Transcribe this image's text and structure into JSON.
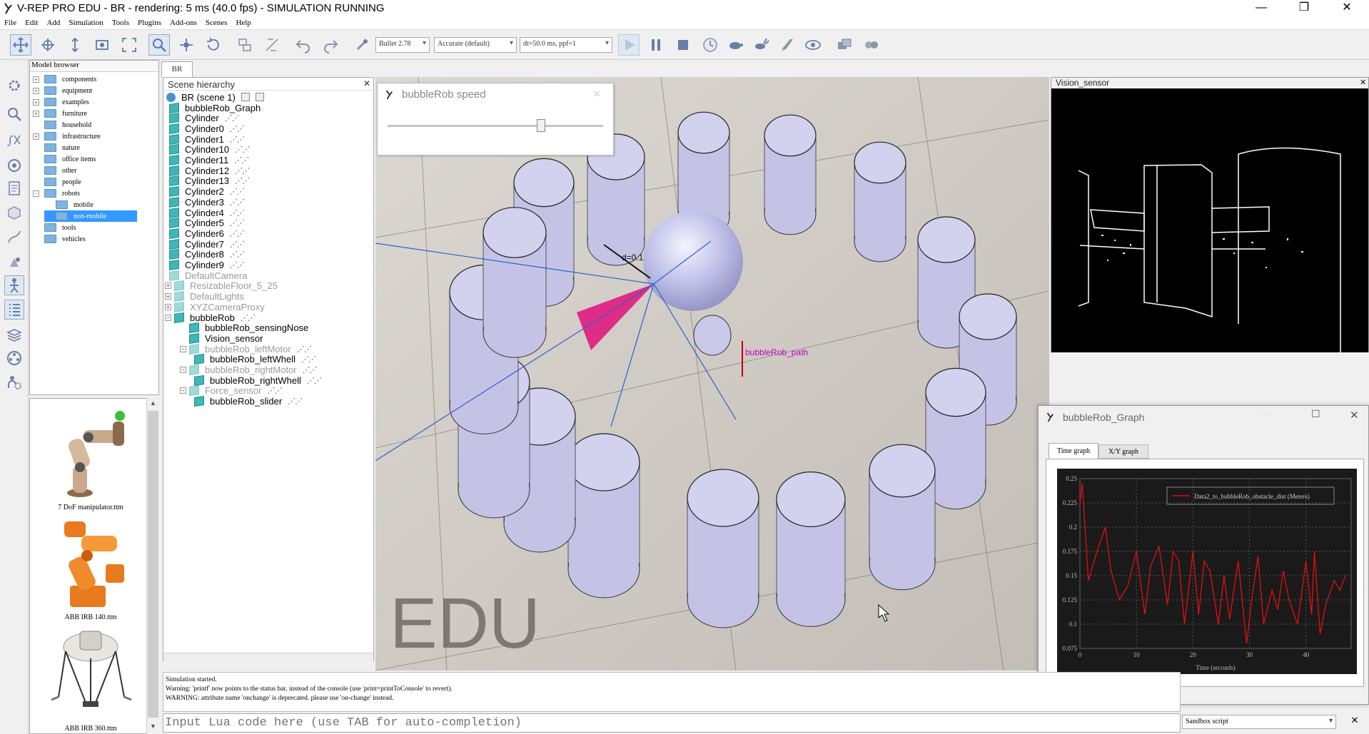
{
  "window": {
    "title": "V-REP PRO EDU - BR - rendering: 5 ms (40.0 fps) - SIMULATION RUNNING",
    "minimize": "—",
    "restore": "❐",
    "close": "✕"
  },
  "menu": [
    "File",
    "Edit",
    "Add",
    "Simulation",
    "Tools",
    "Plugins",
    "Add-ons",
    "Scenes",
    "Help"
  ],
  "toolbar": {
    "engine": "Bullet 2.78",
    "accuracy": "Accurate (default)",
    "timestep": "dt=50.0 ms, ppf=1"
  },
  "model_browser": {
    "header": "Model browser",
    "items": [
      {
        "label": "components",
        "exp": "+"
      },
      {
        "label": "equipment",
        "exp": "+"
      },
      {
        "label": "examples",
        "exp": "+"
      },
      {
        "label": "furniture",
        "exp": "+"
      },
      {
        "label": "household",
        "exp": ""
      },
      {
        "label": "infrastructure",
        "exp": "+"
      },
      {
        "label": "nature",
        "exp": ""
      },
      {
        "label": "office items",
        "exp": ""
      },
      {
        "label": "other",
        "exp": ""
      },
      {
        "label": "people",
        "exp": ""
      },
      {
        "label": "robots",
        "exp": "−"
      },
      {
        "label": "mobile",
        "exp": ""
      },
      {
        "label": "non-mobile",
        "exp": ""
      },
      {
        "label": "tools",
        "exp": ""
      },
      {
        "label": "vehicles",
        "exp": ""
      }
    ],
    "selected": "non-mobile",
    "thumbnails": [
      "7 DoF manipulator.ttm",
      "ABB IRB 140.ttm",
      "ABB IRB 360.ttm"
    ]
  },
  "scene_tab": "BR",
  "scene_hierarchy": {
    "header": "Scene hierarchy",
    "close": "✕",
    "root": "BR (scene 1)",
    "items": [
      {
        "label": "bubbleRob_Graph",
        "dim": false
      },
      {
        "label": "Cylinder",
        "dim": false
      },
      {
        "label": "Cylinder0",
        "dim": false
      },
      {
        "label": "Cylinder1",
        "dim": false
      },
      {
        "label": "Cylinder10",
        "dim": false
      },
      {
        "label": "Cylinder11",
        "dim": false
      },
      {
        "label": "Cylinder12",
        "dim": false
      },
      {
        "label": "Cylinder13",
        "dim": false
      },
      {
        "label": "Cylinder2",
        "dim": false
      },
      {
        "label": "Cylinder3",
        "dim": false
      },
      {
        "label": "Cylinder4",
        "dim": false
      },
      {
        "label": "Cylinder5",
        "dim": false
      },
      {
        "label": "Cylinder6",
        "dim": false
      },
      {
        "label": "Cylinder7",
        "dim": false
      },
      {
        "label": "Cylinder8",
        "dim": false
      },
      {
        "label": "Cylinder9",
        "dim": false
      },
      {
        "label": "DefaultCamera",
        "dim": true
      },
      {
        "label": "ResizableFloor_5_25",
        "dim": true
      },
      {
        "label": "DefaultLights",
        "dim": true
      },
      {
        "label": "XYZCameraProxy",
        "dim": true
      },
      {
        "label": "bubbleRob",
        "dim": false
      },
      {
        "label": "bubbleRob_sensingNose",
        "dim": false
      },
      {
        "label": "Vision_sensor",
        "dim": false
      },
      {
        "label": "bubbleRob_leftMotor",
        "dim": true
      },
      {
        "label": "bubbleRob_leftWhell",
        "dim": false
      },
      {
        "label": "bubbleRob_rightMotor",
        "dim": true
      },
      {
        "label": "bubbleRob_rightWhell",
        "dim": false
      },
      {
        "label": "Force_sensor",
        "dim": true
      },
      {
        "label": "bubbleRob_slider",
        "dim": false
      }
    ]
  },
  "speed_dialog": {
    "title": "bubbleRob speed",
    "slider_value": 0.72
  },
  "viewport": {
    "watermark": "EDU",
    "distance_label": "d=0.1",
    "path_label": "bubbleRob_path"
  },
  "vision_panel": {
    "title": "Vision_sensor",
    "close": "✕"
  },
  "graph_window": {
    "title": "bubbleRob_Graph",
    "tabs": [
      "Time graph",
      "X/Y graph"
    ],
    "active_tab": "Time graph"
  },
  "chart_data": {
    "type": "line",
    "title": "",
    "xlabel": "Time (seconds)",
    "ylabel": "",
    "xlim": [
      0,
      48
    ],
    "ylim": [
      0.075,
      0.25
    ],
    "xticks": [
      0,
      10,
      20,
      30,
      40
    ],
    "yticks": [
      0.075,
      0.1,
      0.125,
      0.15,
      0.175,
      0.2,
      0.225,
      0.25
    ],
    "grid": true,
    "legend_position": "top-right",
    "series": [
      {
        "name": "Data2_to_bubbleRob_obstacle_dist (Meters)",
        "color": "#e01010",
        "x": [
          0,
          0.4,
          1.5,
          3,
          4.5,
          5.5,
          7,
          8.5,
          10,
          11.5,
          12.5,
          14,
          15.5,
          16.5,
          17.5,
          18.5,
          20,
          21,
          22,
          23,
          24.5,
          25.5,
          26.5,
          28,
          29.5,
          30.5,
          31.5,
          32.5,
          34,
          35,
          36,
          37,
          38.5,
          40,
          41,
          41.5,
          42.5,
          43.5,
          45,
          46,
          47
        ],
        "y": [
          0.225,
          0.245,
          0.145,
          0.175,
          0.2,
          0.155,
          0.125,
          0.14,
          0.175,
          0.11,
          0.16,
          0.18,
          0.12,
          0.175,
          0.165,
          0.1,
          0.175,
          0.11,
          0.165,
          0.155,
          0.1,
          0.15,
          0.105,
          0.165,
          0.08,
          0.13,
          0.17,
          0.1,
          0.135,
          0.115,
          0.155,
          0.125,
          0.1,
          0.165,
          0.11,
          0.175,
          0.09,
          0.12,
          0.145,
          0.135,
          0.15
        ]
      }
    ]
  },
  "console": {
    "lines": [
      "Simulation started.",
      "Warning: 'printf' now points to the status bar, instead of the console (use 'print=printToConsole' to revert).",
      "WARNING: attribute name 'onchange' is deprecated. please use 'on-change' instead."
    ],
    "input_placeholder": "Input Lua code here (use TAB for auto-completion)",
    "script_mode": "Sandbox script",
    "close": "✕"
  },
  "colors": {
    "selection": "#3399ff",
    "cylinder": "#c9c8e8",
    "cone": "#e0107a",
    "path_label": "#c000c0",
    "graph_bg": "#1a1a1a",
    "series": "#e01010"
  }
}
